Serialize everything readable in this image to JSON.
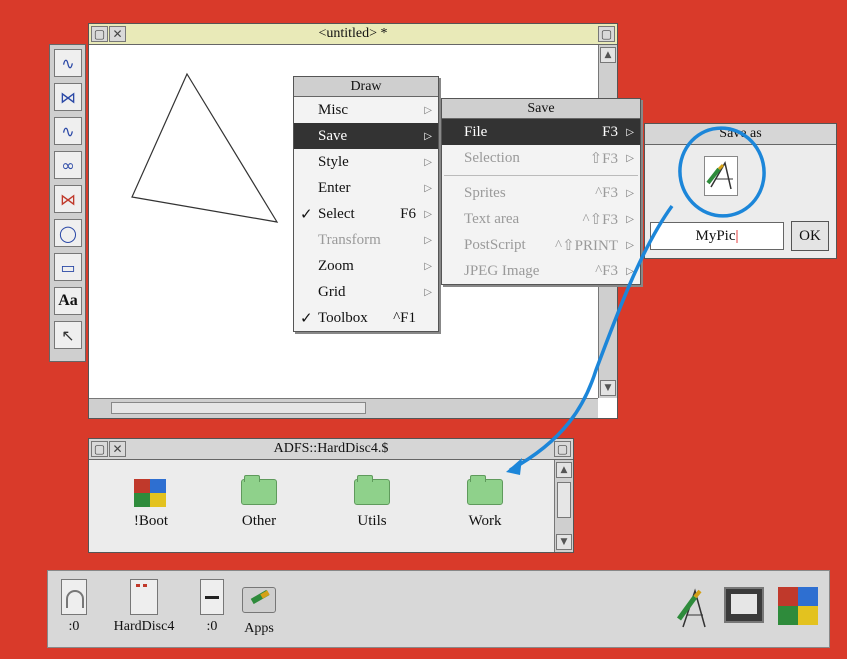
{
  "draw_window": {
    "title": "<untitled> *",
    "back_icon": "back-icon",
    "close_icon": "close-icon",
    "toggle_icon": "toggle-size-icon"
  },
  "toolbox": {
    "tools": [
      "open-curve-icon",
      "closed-curve-icon",
      "open-line-icon",
      "closed-line-icon",
      "autocurve-icon",
      "ellipse-icon",
      "rectangle-icon",
      "text-icon",
      "select-icon"
    ],
    "text_tool_glyph": "Aa"
  },
  "draw_menu": {
    "title": "Draw",
    "items": [
      {
        "label": "Misc",
        "shortcut": "",
        "tick": false,
        "disabled": false,
        "highlighted": false,
        "submenu": true
      },
      {
        "label": "Save",
        "shortcut": "",
        "tick": false,
        "disabled": false,
        "highlighted": true,
        "submenu": true
      },
      {
        "label": "Style",
        "shortcut": "",
        "tick": false,
        "disabled": false,
        "highlighted": false,
        "submenu": true
      },
      {
        "label": "Enter",
        "shortcut": "",
        "tick": false,
        "disabled": false,
        "highlighted": false,
        "submenu": true
      },
      {
        "label": "Select",
        "shortcut": "F6",
        "tick": true,
        "disabled": false,
        "highlighted": false,
        "submenu": true
      },
      {
        "label": "Transform",
        "shortcut": "",
        "tick": false,
        "disabled": true,
        "highlighted": false,
        "submenu": true
      },
      {
        "label": "Zoom",
        "shortcut": "",
        "tick": false,
        "disabled": false,
        "highlighted": false,
        "submenu": true
      },
      {
        "label": "Grid",
        "shortcut": "",
        "tick": false,
        "disabled": false,
        "highlighted": false,
        "submenu": true
      },
      {
        "label": "Toolbox",
        "shortcut": "^F1",
        "tick": true,
        "disabled": false,
        "highlighted": false,
        "submenu": false
      }
    ],
    "tick_glyph": "✓"
  },
  "save_menu": {
    "title": "Save",
    "items": [
      {
        "label": "File",
        "shortcut": "F3",
        "disabled": false,
        "highlighted": true
      },
      {
        "label": "Selection",
        "shortcut": "⇧F3",
        "disabled": true,
        "highlighted": false
      },
      {
        "label": "Sprites",
        "shortcut": "^F3",
        "disabled": true,
        "highlighted": false
      },
      {
        "label": "Text area",
        "shortcut": "^⇧F3",
        "disabled": true,
        "highlighted": false
      },
      {
        "label": "PostScript",
        "shortcut": "^⇧PRINT",
        "disabled": true,
        "highlighted": false
      },
      {
        "label": "JPEG Image",
        "shortcut": "^F3",
        "disabled": true,
        "highlighted": false
      }
    ]
  },
  "save_as": {
    "title": "Save as",
    "filename": "MyPic",
    "ok_label": "OK",
    "file_icon": "drawfile-icon"
  },
  "filer_window": {
    "title": "ADFS::HardDisc4.$",
    "items": [
      {
        "label": "!Boot",
        "icon": "boot-app-icon"
      },
      {
        "label": "Other",
        "icon": "folder-icon"
      },
      {
        "label": "Utils",
        "icon": "folder-icon"
      },
      {
        "label": "Work",
        "icon": "folder-icon"
      }
    ]
  },
  "iconbar": {
    "left_items": [
      {
        "label": ":0",
        "icon": "floppy-drive-icon"
      },
      {
        "label": "HardDisc4",
        "icon": "hard-disc-icon"
      },
      {
        "label": ":0",
        "icon": "ram-disc-icon"
      },
      {
        "label": "Apps",
        "icon": "apps-folder-icon"
      }
    ],
    "right_items": [
      "draw-app-icon",
      "display-manager-icon",
      "task-manager-icon"
    ]
  },
  "colors": {
    "desktop": "#d93a2a",
    "annotation": "#1c86d9",
    "toolbox_glyph": "#2a48a6",
    "folder": "#8fd18b"
  }
}
